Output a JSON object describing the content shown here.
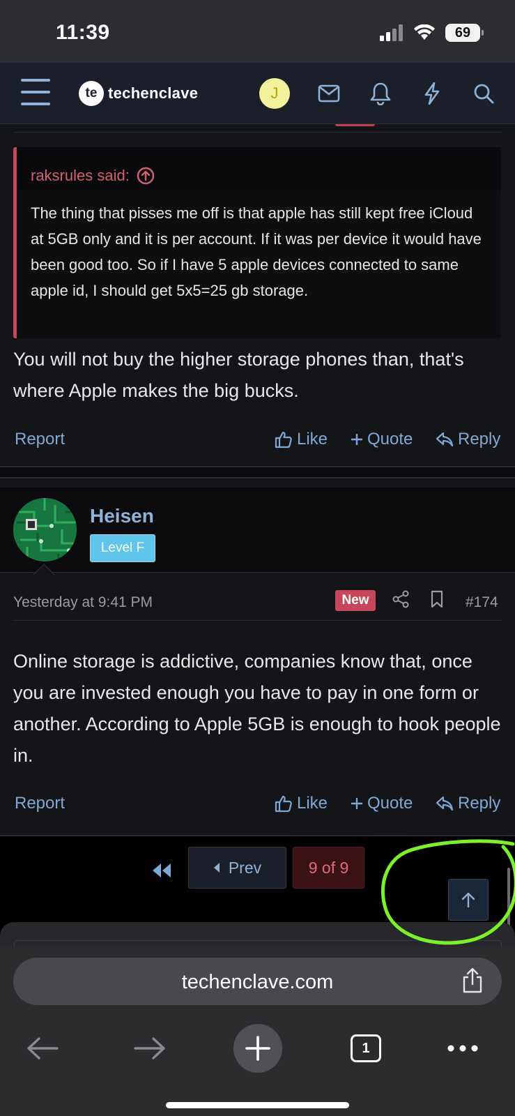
{
  "status_bar": {
    "time": "11:39",
    "battery": "69"
  },
  "header": {
    "logo_mark": "te",
    "logo_text": "techenclave",
    "user_initial": "J"
  },
  "quote": {
    "author_label": "raksrules said:",
    "text": "The thing that pisses me off is that apple has still kept free iCloud at 5GB only and it is per account. If it was per device it would have been good too. So if I have 5 apple devices connected to same apple id, I should get 5x5=25 gb storage."
  },
  "post1": {
    "text": "You will not buy the higher storage phones than, that's where Apple makes the big bucks.",
    "actions": {
      "report": "Report",
      "like": "Like",
      "quote": "Quote",
      "reply": "Reply"
    }
  },
  "post2": {
    "username": "Heisen",
    "badge": "Level F",
    "date": "Yesterday at 9:41 PM",
    "new_label": "New",
    "post_number": "#174",
    "text": "Online storage is addictive, companies know that, once you are invested enough you have to pay in one form or another. According to Apple 5GB is enough to hook people in.",
    "actions": {
      "report": "Report",
      "like": "Like",
      "quote": "Quote",
      "reply": "Reply"
    }
  },
  "pagination": {
    "prev": "Prev",
    "current": "9 of 9"
  },
  "browser": {
    "url": "techenclave.com",
    "tab_count": "1"
  },
  "colors": {
    "accent_link": "#7fa9d4",
    "new_badge": "#c6475a",
    "highlight": "#7cf02a"
  },
  "icons": [
    "hamburger-icon",
    "mail-icon",
    "bell-icon",
    "lightning-icon",
    "search-icon",
    "arrow-up-circle-icon",
    "thumbs-up-icon",
    "plus-icon",
    "reply-icon",
    "share-icon",
    "bookmark-icon",
    "first-page-icon",
    "caret-left-icon",
    "arrow-up-icon",
    "share-url-icon",
    "back-icon",
    "forward-icon",
    "new-tab-icon",
    "more-icon"
  ]
}
